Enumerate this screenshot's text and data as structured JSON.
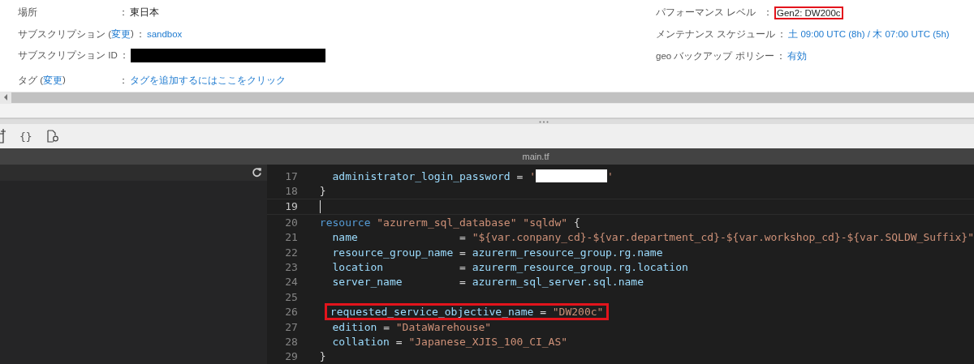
{
  "properties": {
    "left": [
      {
        "label": "場所",
        "separator": "：",
        "value": "東日本",
        "kind": "text"
      },
      {
        "label": "サブスクリプション (",
        "link": "変更",
        "label_end": ")",
        "separator": "：",
        "value": "sandbox",
        "kind": "link"
      },
      {
        "label": "サブスクリプション ID",
        "separator": "：",
        "kind": "redacted"
      },
      {
        "label": "タグ (",
        "link": "変更",
        "label_end": ")",
        "separator": "：",
        "value": "タグを追加するにはここをクリック",
        "kind": "link"
      }
    ],
    "right": [
      {
        "label": "パフォーマンス レベル",
        "separator": "：",
        "value": "Gen2: DW200c",
        "kind": "text",
        "highlighted": true
      },
      {
        "label": "メンテナンス スケジュール",
        "separator": "：",
        "value": "土 09:00 UTC (8h) / 木 07:00 UTC (5h)",
        "kind": "link",
        "highlighted": false
      },
      {
        "label": "geo バックアップ ポリシー",
        "separator": "：",
        "value": "有効",
        "kind": "link",
        "highlighted": false
      }
    ]
  },
  "toolbar": {
    "braces": "{}"
  },
  "editor": {
    "file_name": "main.tf",
    "lines": [
      {
        "number": "17",
        "current": false,
        "highlighted": false,
        "tokens": [
          {
            "kind": "key",
            "text": "  administrator_login_password "
          },
          {
            "kind": "op",
            "text": "= "
          },
          {
            "kind": "str",
            "text": "'"
          },
          {
            "kind": "redacted"
          },
          {
            "kind": "str",
            "text": "'"
          }
        ]
      },
      {
        "number": "18",
        "current": false,
        "highlighted": false,
        "tokens": [
          {
            "kind": "op",
            "text": "}"
          }
        ]
      },
      {
        "number": "19",
        "current": true,
        "highlighted": false
      },
      {
        "number": "20",
        "current": false,
        "highlighted": false,
        "tokens": [
          {
            "kind": "keyword",
            "text": "resource "
          },
          {
            "kind": "str",
            "text": "\"azurerm_sql_database\" \"sqldw\""
          },
          {
            "kind": "op",
            "text": " {"
          }
        ]
      },
      {
        "number": "21",
        "current": false,
        "highlighted": false,
        "tokens": [
          {
            "kind": "key",
            "text": "  name                "
          },
          {
            "kind": "op",
            "text": "= "
          },
          {
            "kind": "str",
            "text": "\"${var.conpany_cd}-${var.department_cd}-${var.workshop_cd}-${var.SQLDW_Suffix}\""
          }
        ]
      },
      {
        "number": "22",
        "current": false,
        "highlighted": false,
        "tokens": [
          {
            "kind": "key",
            "text": "  resource_group_name "
          },
          {
            "kind": "op",
            "text": "= "
          },
          {
            "kind": "key",
            "text": "azurerm_resource_group.rg.name"
          }
        ]
      },
      {
        "number": "23",
        "current": false,
        "highlighted": false,
        "tokens": [
          {
            "kind": "key",
            "text": "  location            "
          },
          {
            "kind": "op",
            "text": "= "
          },
          {
            "kind": "key",
            "text": "azurerm_resource_group.rg.location"
          }
        ]
      },
      {
        "number": "24",
        "current": false,
        "highlighted": false,
        "tokens": [
          {
            "kind": "key",
            "text": "  server_name         "
          },
          {
            "kind": "op",
            "text": "= "
          },
          {
            "kind": "key",
            "text": "azurerm_sql_server.sql.name"
          }
        ]
      },
      {
        "number": "25",
        "current": false,
        "highlighted": false
      },
      {
        "number": "26",
        "current": false,
        "highlighted": true,
        "tokens": [
          {
            "kind": "key",
            "text": "requested_service_objective_name "
          },
          {
            "kind": "op",
            "text": "= "
          },
          {
            "kind": "str",
            "text": "\"DW200c\""
          }
        ]
      },
      {
        "number": "27",
        "current": false,
        "highlighted": false,
        "tokens": [
          {
            "kind": "key",
            "text": "  edition "
          },
          {
            "kind": "op",
            "text": "= "
          },
          {
            "kind": "str",
            "text": "\"DataWarehouse\""
          }
        ]
      },
      {
        "number": "28",
        "current": false,
        "highlighted": false,
        "tokens": [
          {
            "kind": "key",
            "text": "  collation "
          },
          {
            "kind": "op",
            "text": "= "
          },
          {
            "kind": "str",
            "text": "\"Japanese_XJIS_100_CI_AS\""
          }
        ]
      },
      {
        "number": "29",
        "current": false,
        "highlighted": false,
        "tokens": [
          {
            "kind": "op",
            "text": "}"
          }
        ]
      }
    ]
  }
}
